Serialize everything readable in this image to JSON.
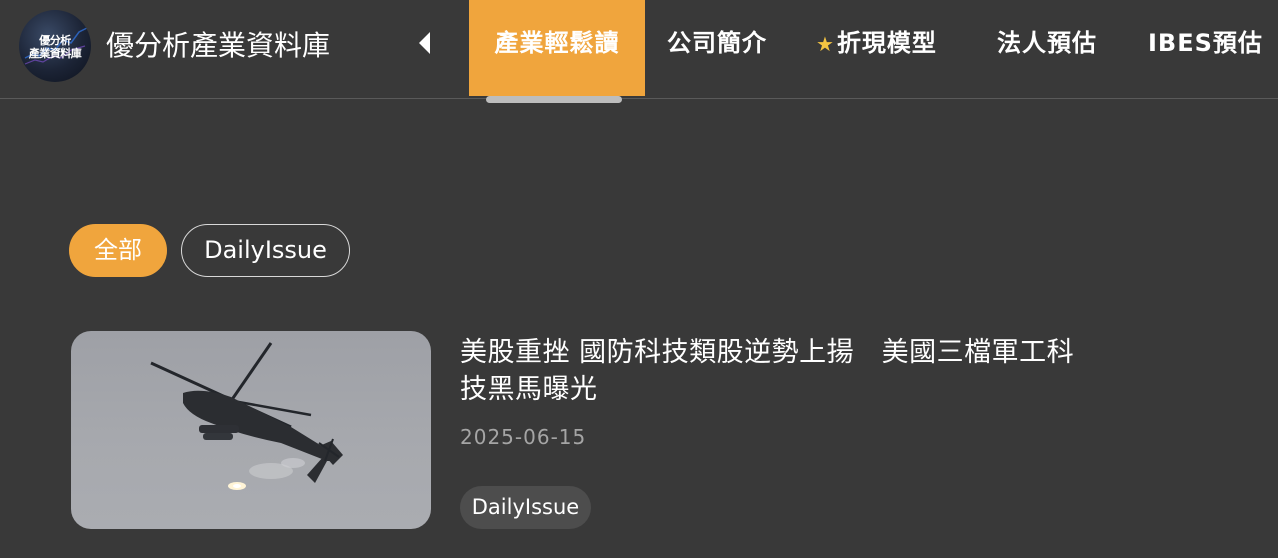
{
  "header": {
    "logo_text_line1": "優分析",
    "logo_text_line2": "產業資料庫",
    "site_title": "優分析產業資料庫",
    "prev_icon": "chevron-left-icon",
    "tabs": [
      {
        "label": "產業輕鬆讀",
        "active": true
      },
      {
        "label": "公司簡介",
        "active": false
      },
      {
        "label": "折現模型",
        "icon": "star-icon",
        "active": false
      },
      {
        "label": "法人預估",
        "active": false
      },
      {
        "label": "IBES預估",
        "active": false
      }
    ],
    "accent_color": "#f0a53d",
    "background_color": "#393939"
  },
  "filters": [
    {
      "label": "全部",
      "selected": true
    },
    {
      "label": "DailyIssue",
      "selected": false
    }
  ],
  "articles": [
    {
      "title": "美股重挫 國防科技類股逆勢上揚　美國三檔軍工科技黑馬曝光",
      "date": "2025-06-15",
      "tag": "DailyIssue",
      "thumbnail": "helicopter-photo"
    }
  ]
}
